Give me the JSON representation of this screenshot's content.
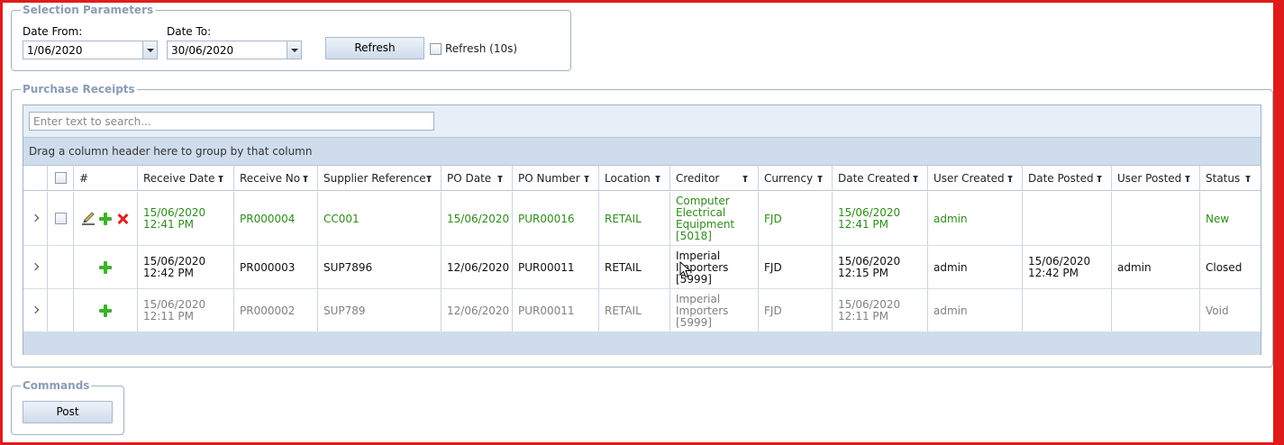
{
  "selection": {
    "legend": "Selection Parameters",
    "date_from_label": "Date From:",
    "date_from_value": "1/06/2020",
    "date_to_label": "Date To:",
    "date_to_value": "30/06/2020",
    "refresh_label": "Refresh",
    "auto_refresh_label": "Refresh (10s)"
  },
  "receipts": {
    "legend": "Purchase Receipts",
    "search_placeholder": "Enter text to search...",
    "group_hint": "Drag a column header here to group by that column",
    "columns": {
      "num": "#",
      "receive_date": "Receive Date",
      "receive_no": "Receive No",
      "supplier_ref": "Supplier Reference",
      "po_date": "PO Date",
      "po_number": "PO Number",
      "location": "Location",
      "creditor": "Creditor",
      "currency": "Currency",
      "date_created": "Date Created",
      "user_created": "User Created",
      "date_posted": "Date Posted",
      "user_posted": "User Posted",
      "status": "Status"
    },
    "rows": [
      {
        "receive_date": "15/06/2020\n12:41 PM",
        "receive_no": "PR000004",
        "supplier_ref": "CC001",
        "po_date": "15/06/2020",
        "po_number": "PUR00016",
        "location": "RETAIL",
        "creditor": "Computer\nElectrical\nEquipment\n[5018]",
        "currency": "FJD",
        "date_created": "15/06/2020\n12:41 PM",
        "user_created": "admin",
        "date_posted": "",
        "user_posted": "",
        "status": "New",
        "color": "#2e8b1a"
      },
      {
        "receive_date": "15/06/2020\n12:42 PM",
        "receive_no": "PR000003",
        "supplier_ref": "SUP7896",
        "po_date": "12/06/2020",
        "po_number": "PUR00011",
        "location": "RETAIL",
        "creditor": "Imperial\nImporters\n[5999]",
        "currency": "FJD",
        "date_created": "15/06/2020\n12:15 PM",
        "user_created": "admin",
        "date_posted": "15/06/2020\n12:42 PM",
        "user_posted": "admin",
        "status": "Closed",
        "color": "#111111"
      },
      {
        "receive_date": "15/06/2020\n12:11 PM",
        "receive_no": "PR000002",
        "supplier_ref": "SUP789",
        "po_date": "12/06/2020",
        "po_number": "PUR00011",
        "location": "RETAIL",
        "creditor": "Imperial\nImporters\n[5999]",
        "currency": "FJD",
        "date_created": "15/06/2020\n12:11 PM",
        "user_created": "admin",
        "date_posted": "",
        "user_posted": "",
        "status": "Void",
        "color": "#808080"
      }
    ]
  },
  "commands": {
    "legend": "Commands",
    "post_label": "Post"
  }
}
